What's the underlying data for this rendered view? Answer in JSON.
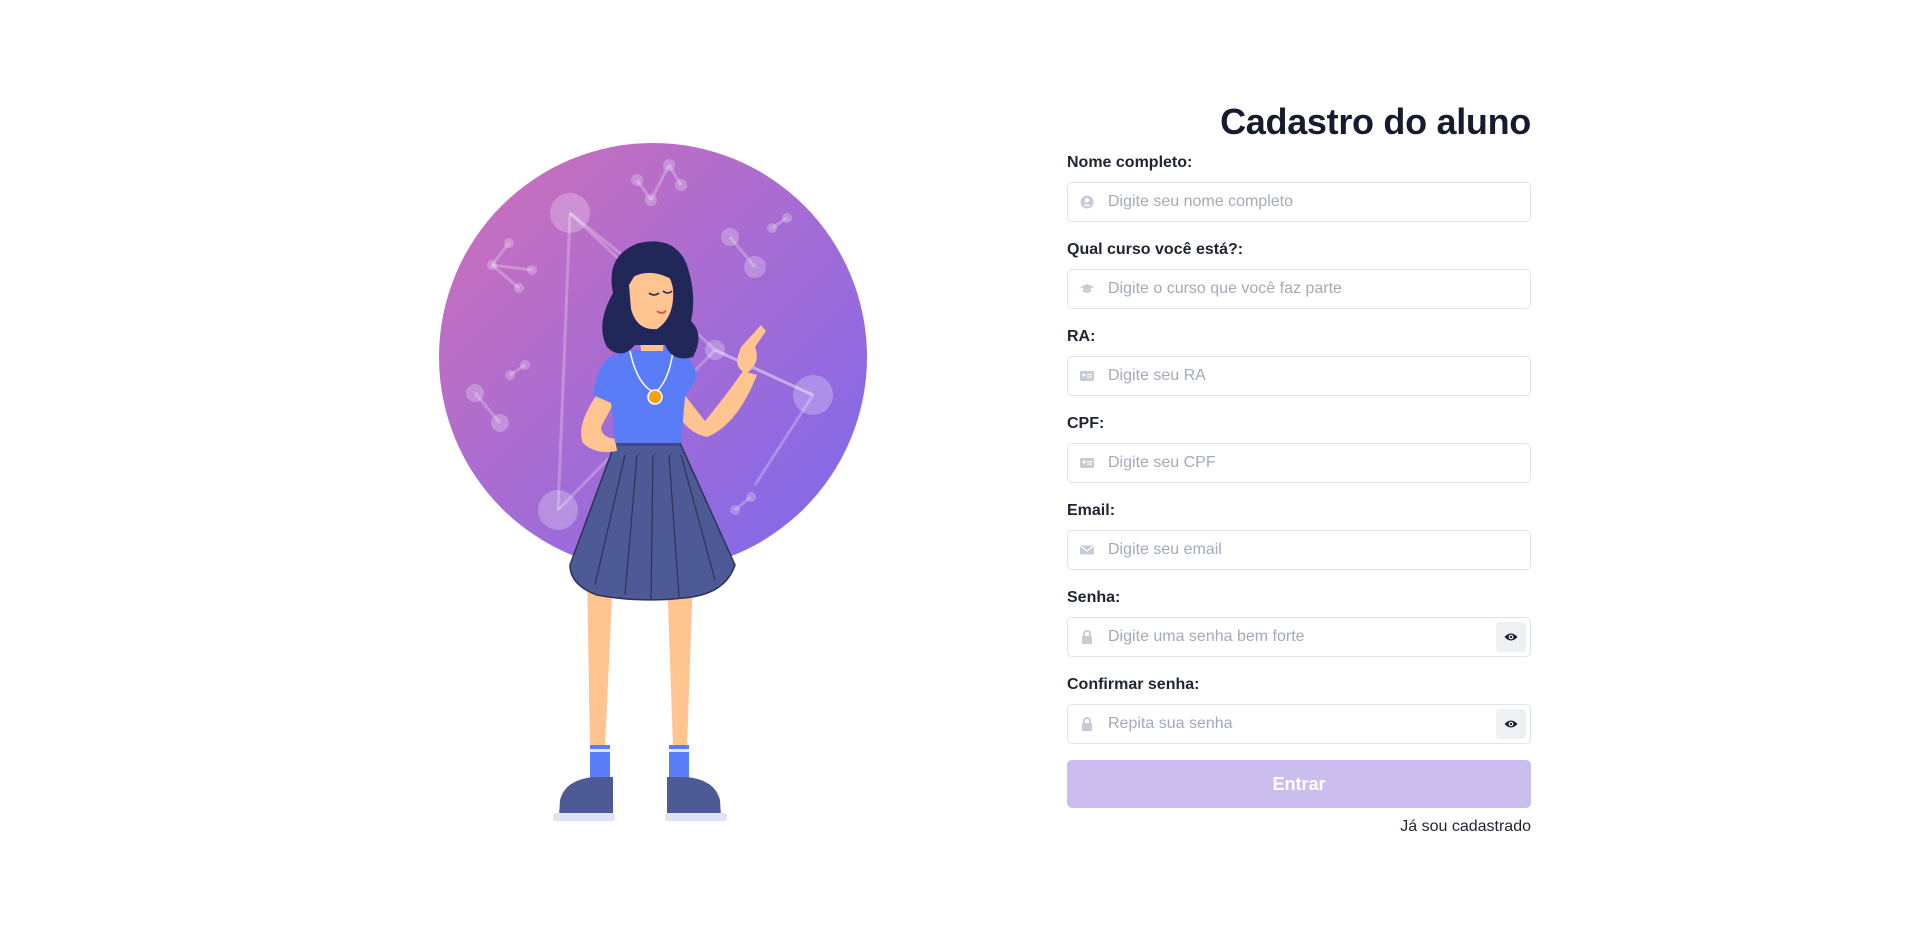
{
  "page": {
    "title": "Cadastro do aluno"
  },
  "fields": [
    {
      "label": "Nome completo:",
      "placeholder": "Digite seu nome completo",
      "icon": "user-icon"
    },
    {
      "label": "Qual curso você está?:",
      "placeholder": "Digite o curso que você faz parte",
      "icon": "graduation-cap-icon"
    },
    {
      "label": "RA:",
      "placeholder": "Digite seu RA",
      "icon": "id-card-icon"
    },
    {
      "label": "CPF:",
      "placeholder": "Digite seu CPF",
      "icon": "id-card-icon"
    },
    {
      "label": "Email:",
      "placeholder": "Digite seu email",
      "icon": "envelope-icon"
    },
    {
      "label": "Senha:",
      "placeholder": "Digite uma senha bem forte",
      "icon": "lock-icon",
      "toggle_icon": "eye-icon"
    },
    {
      "label": "Confirmar senha:",
      "placeholder": "Repita sua senha",
      "icon": "lock-icon",
      "toggle_icon": "eye-icon"
    }
  ],
  "submit": {
    "label": "Entrar"
  },
  "login_link": {
    "label": "Já sou cadastrado"
  },
  "colors": {
    "button_bg": "#cbbdee",
    "title": "#161c2d",
    "circle_gradient_start": "#d070b8",
    "circle_gradient_end": "#7b68ee",
    "shirt": "#5b7cf7",
    "skirt": "#4e5a95"
  }
}
